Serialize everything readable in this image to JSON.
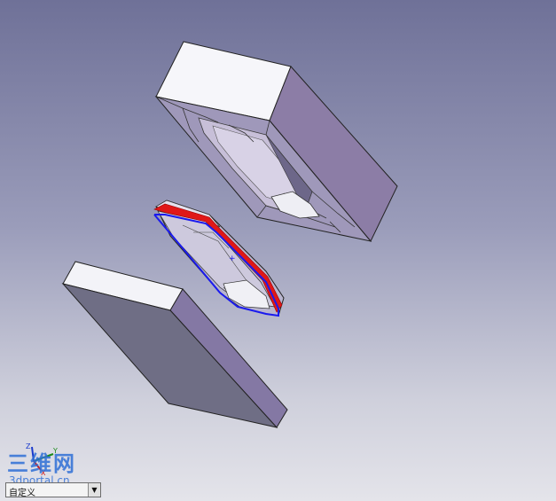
{
  "viewport": {
    "background_top": "#6f7198",
    "background_bottom": "#e4e4ea"
  },
  "model": {
    "parts": [
      "core-block",
      "part-shell",
      "cavity-block"
    ],
    "highlight_colors": {
      "parting_face": "#e01818",
      "parting_edge": "#1a1aee"
    }
  },
  "triad": {
    "x_label": "X",
    "y_label": "Y",
    "z_label": "Z"
  },
  "watermark": {
    "title": "三维网",
    "url": "3dportal.cn"
  },
  "view_selector": {
    "value": "自定义",
    "arrow_icon": "chevron-down-icon"
  }
}
